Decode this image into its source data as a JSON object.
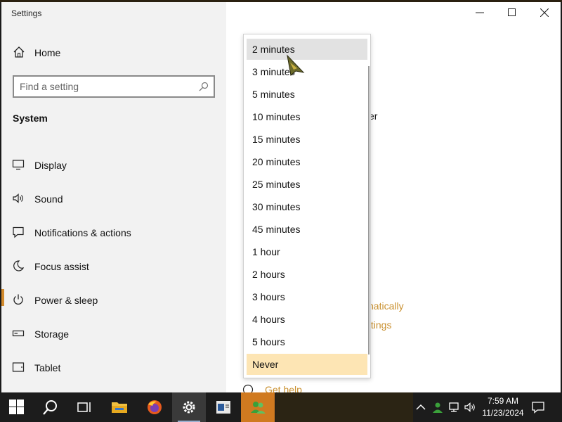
{
  "window": {
    "title": "Settings",
    "controls": [
      "minimize",
      "maximize",
      "close"
    ]
  },
  "sidebar": {
    "home_label": "Home",
    "search_placeholder": "Find a setting",
    "section_heading": "System",
    "items": [
      {
        "label": "Display",
        "icon": "monitor-icon"
      },
      {
        "label": "Sound",
        "icon": "speaker-icon"
      },
      {
        "label": "Notifications & actions",
        "icon": "notification-icon"
      },
      {
        "label": "Focus assist",
        "icon": "moon-icon"
      },
      {
        "label": "Power & sleep",
        "icon": "power-icon",
        "active": true
      },
      {
        "label": "Storage",
        "icon": "storage-icon"
      },
      {
        "label": "Tablet",
        "icon": "tablet-icon"
      }
    ]
  },
  "main": {
    "partial_text_1": "er",
    "partial_link_1": "natically",
    "partial_link_2": "ttings",
    "help_link": "Get help"
  },
  "dropdown": {
    "options": [
      "2 minutes",
      "3 minutes",
      "5 minutes",
      "10 minutes",
      "15 minutes",
      "20 minutes",
      "25 minutes",
      "30 minutes",
      "45 minutes",
      "1 hour",
      "2 hours",
      "3 hours",
      "4 hours",
      "5 hours",
      "Never"
    ],
    "hovered": "2 minutes",
    "selected": "Never"
  },
  "taskbar": {
    "apps": [
      "start-icon",
      "search-icon",
      "task-view-icon",
      "file-explorer-icon",
      "firefox-icon",
      "settings-icon",
      "terminal-icon",
      "people-icon"
    ],
    "clock_time": "7:59 AM",
    "clock_date": "11/23/2024"
  },
  "colors": {
    "accent": "#d28a2c",
    "link": "#c9902f",
    "selected_option": "#fde5b4",
    "hover_option": "#e2e2e2",
    "sidebar_bg": "#f2f2f2",
    "taskbar_bg": "#1c1c1c"
  }
}
